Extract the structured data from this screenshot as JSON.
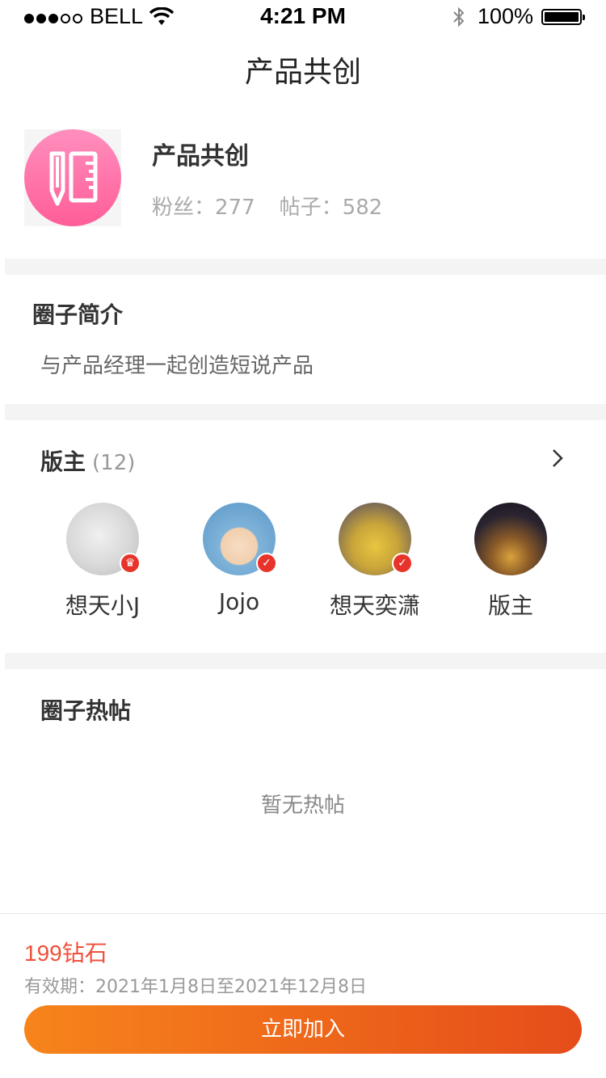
{
  "status_bar": {
    "carrier": "BELL",
    "time": "4:21 PM",
    "battery": "100%"
  },
  "nav": {
    "title": "产品共创"
  },
  "circle": {
    "name": "产品共创",
    "fans_label": "粉丝：",
    "fans_count": "277",
    "posts_label": "帖子：",
    "posts_count": "582",
    "logo_icon": "ruler-pencil-icon"
  },
  "intro": {
    "title": "圈子简介",
    "text": "与产品经理一起创造短说产品"
  },
  "moderators": {
    "title": "版主",
    "count": "(12)",
    "items": [
      {
        "name": "想天小J",
        "badge_icon": "moderator-badge-icon"
      },
      {
        "name": "Jojo",
        "badge_icon": "verified-badge-icon"
      },
      {
        "name": "想天奕潇",
        "badge_icon": "verified-badge-icon"
      },
      {
        "name": "版主",
        "badge_icon": ""
      }
    ]
  },
  "hot_posts": {
    "title": "圈子热帖",
    "empty_text": "暂无热帖"
  },
  "footer": {
    "price": "199钻石",
    "validity": "有效期：2021年1月8日至2021年12月8日",
    "join_label": "立即加入"
  },
  "colors": {
    "accent": "#f0503c",
    "button_start": "#f7841b",
    "button_end": "#e54d1a",
    "logo_pink": "#ff6fa5"
  }
}
